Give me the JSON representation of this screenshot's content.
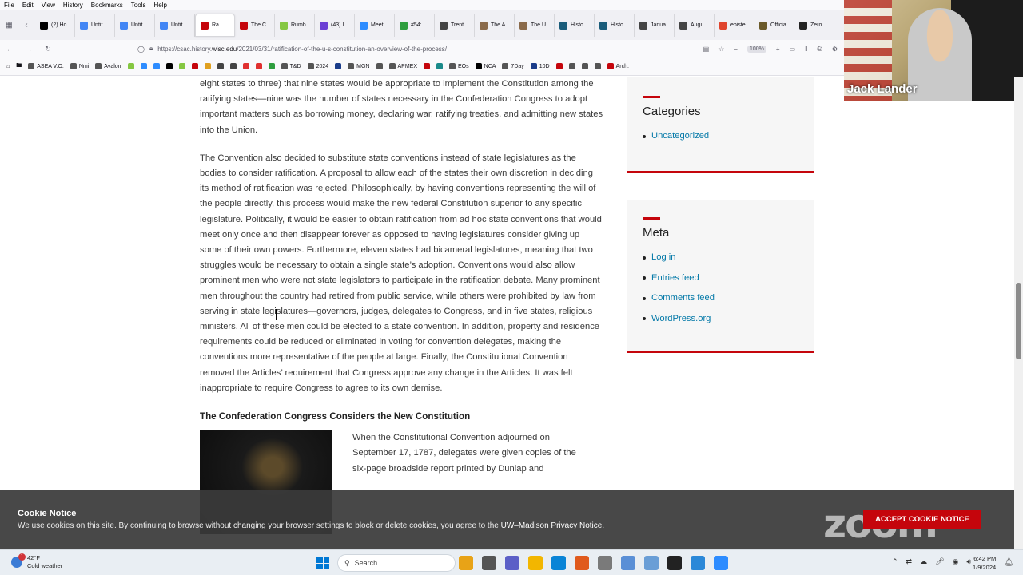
{
  "menubar": [
    "File",
    "Edit",
    "View",
    "History",
    "Bookmarks",
    "Tools",
    "Help"
  ],
  "tabs": [
    {
      "label": "(2) Ho",
      "color": "#000000"
    },
    {
      "label": "Untit",
      "color": "#4285f4"
    },
    {
      "label": "Untit",
      "color": "#4285f4"
    },
    {
      "label": "Untit",
      "color": "#4285f4"
    },
    {
      "label": "Ra",
      "color": "#c5050c",
      "active": true
    },
    {
      "label": "The C",
      "color": "#c5050c"
    },
    {
      "label": "Rumb",
      "color": "#85c742"
    },
    {
      "label": "(43) I",
      "color": "#6b3fd4"
    },
    {
      "label": "Meet",
      "color": "#2d8cff"
    },
    {
      "label": "#54:",
      "color": "#2e9e3e"
    },
    {
      "label": "Trent",
      "color": "#444444"
    },
    {
      "label": "The A",
      "color": "#8a6a4a"
    },
    {
      "label": "The U",
      "color": "#8a6a4a"
    },
    {
      "label": "Histo",
      "color": "#1a5c7a"
    },
    {
      "label": "Histo",
      "color": "#1a5c7a"
    },
    {
      "label": "Janua",
      "color": "#444444"
    },
    {
      "label": "Augu",
      "color": "#444444"
    },
    {
      "label": "episte",
      "color": "#e0442d"
    },
    {
      "label": "Officia",
      "color": "#6b5a2a"
    },
    {
      "label": "Zero",
      "color": "#222222"
    }
  ],
  "url": {
    "prefix": "https://csac.history.",
    "host": "wisc.edu",
    "path": "/2021/03/31/ratification-of-the-u-s-constitution-an-overview-of-the-process/"
  },
  "zoom_level": "100%",
  "bookmarks": [
    {
      "label": "ASEA V.O.",
      "color": "#555"
    },
    {
      "label": "Nmi",
      "color": "#555"
    },
    {
      "label": "Avalon",
      "color": "#555"
    },
    {
      "label": "",
      "color": "#85c742"
    },
    {
      "label": "",
      "color": "#2d8cff"
    },
    {
      "label": "",
      "color": "#2d8cff"
    },
    {
      "label": "",
      "color": "#000"
    },
    {
      "label": "",
      "color": "#85c742"
    },
    {
      "label": "",
      "color": "#c5050c"
    },
    {
      "label": "",
      "color": "#e0a020"
    },
    {
      "label": "",
      "color": "#444"
    },
    {
      "label": "",
      "color": "#444"
    },
    {
      "label": "",
      "color": "#e03030"
    },
    {
      "label": "",
      "color": "#e03030"
    },
    {
      "label": "",
      "color": "#2e9e3e"
    },
    {
      "label": "T&D",
      "color": "#555"
    },
    {
      "label": "2024",
      "color": "#555"
    },
    {
      "label": "",
      "color": "#1a3c8a"
    },
    {
      "label": "MGN",
      "color": "#555"
    },
    {
      "label": "",
      "color": "#555"
    },
    {
      "label": "APMEX",
      "color": "#555"
    },
    {
      "label": "",
      "color": "#c5050c"
    },
    {
      "label": "",
      "color": "#1a8a8a"
    },
    {
      "label": "EOs",
      "color": "#555"
    },
    {
      "label": "NCA",
      "color": "#000"
    },
    {
      "label": "7Day",
      "color": "#555"
    },
    {
      "label": "10D",
      "color": "#1a3c8a"
    },
    {
      "label": "",
      "color": "#c5050c"
    },
    {
      "label": "",
      "color": "#555"
    },
    {
      "label": "",
      "color": "#555"
    },
    {
      "label": "",
      "color": "#555"
    },
    {
      "label": "Arch.",
      "color": "#c5050c"
    }
  ],
  "webcam": {
    "name": "Jack Lander"
  },
  "article": {
    "paragraph1": "eight states to three) that nine states would be appropriate to implement the Constitution among the ratifying states—nine was the number of states necessary in the Confederation Congress to adopt important matters such as borrowing money, declaring war, ratifying treaties, and admitting new states into the Union.",
    "paragraph2": "The Convention also decided to substitute state conventions instead of state legislatures as the bodies to consider ratification. A proposal to allow each of the states their own discretion in deciding its method of ratification was rejected. Philosophically, by having conventions representing the will of the people directly, this process would make the new federal Constitution superior to any specific legislature. Politically, it would be easier to obtain ratification from ad hoc state conventions that would meet only once and then disappear forever as opposed to having legislatures consider giving up some of their own powers. Furthermore, eleven states had bicameral legislatures, meaning that two struggles would be necessary to obtain a single state’s adoption. Conventions would also allow prominent men who were not state legislators to participate in the ratification debate. Many prominent men throughout the country had retired from public service, while others were prohibited by law from serving in state legislatures—governors, judges, delegates to Congress, and in five states, religious ministers. All of these men could be elected to a state convention. In addition, property and residence requirements could be reduced or eliminated in voting for convention delegates, making the conventions more representative of the people at large. Finally, the Constitutional Convention removed the Articles’ requirement that Congress approve any change in the Articles. It was felt inappropriate to require Congress to agree to its own demise.",
    "heading": "The Confederation Congress Considers the New Constitution",
    "figure_text": "When the Constitutional Convention adjourned on September 17, 1787, delegates were given copies of the six-page broadside report printed by Dunlap and"
  },
  "sidebar": {
    "categories": {
      "title": "Categories",
      "items": [
        "Uncategorized"
      ]
    },
    "meta": {
      "title": "Meta",
      "items": [
        "Log in",
        "Entries feed",
        "Comments feed",
        "WordPress.org"
      ]
    }
  },
  "cookie": {
    "title": "Cookie Notice",
    "message": "We use cookies on this site. By continuing to browse without changing your browser settings to block or delete cookies, you agree to the ",
    "link": "UW–Madison Privacy Notice",
    "after_link": ".",
    "button": "ACCEPT COOKIE NOTICE",
    "watermark": "zoom"
  },
  "taskbar": {
    "weather_temp": "42°F",
    "weather_desc": "Cold weather",
    "weather_badge": "1",
    "search_placeholder": "Search",
    "time": "6:42 PM",
    "date": "1/9/2024",
    "apps": [
      "#e8a317",
      "#555555",
      "#5b5fc7",
      "#f2b600",
      "#0a84d6",
      "#e05a1d",
      "#7a7a7a",
      "#5a8fd6",
      "#6a9ed6",
      "#222222",
      "#2b88d8",
      "#2d8cff"
    ]
  },
  "colors": {
    "accent": "#c5050c",
    "link": "#0479a8"
  }
}
